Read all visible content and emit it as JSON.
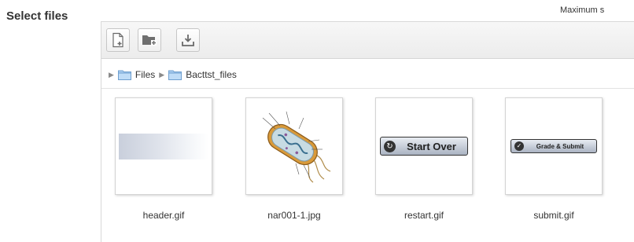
{
  "form": {
    "label": "Select files",
    "max_size_text": "Maximum s"
  },
  "toolbar": {
    "buttons": [
      {
        "name": "add-file-button",
        "icon": "add-file-icon"
      },
      {
        "name": "create-folder-button",
        "icon": "create-folder-icon"
      },
      {
        "name": "download-button",
        "icon": "download-icon"
      }
    ]
  },
  "path": {
    "items": [
      "Files",
      "Bacttst_files"
    ]
  },
  "files": [
    {
      "name": "header.gif",
      "thumb_text": ""
    },
    {
      "name": "nar001-1.jpg",
      "thumb_text": ""
    },
    {
      "name": "restart.gif",
      "thumb_text": "Start Over"
    },
    {
      "name": "submit.gif",
      "thumb_text": "Grade & Submit"
    }
  ]
}
